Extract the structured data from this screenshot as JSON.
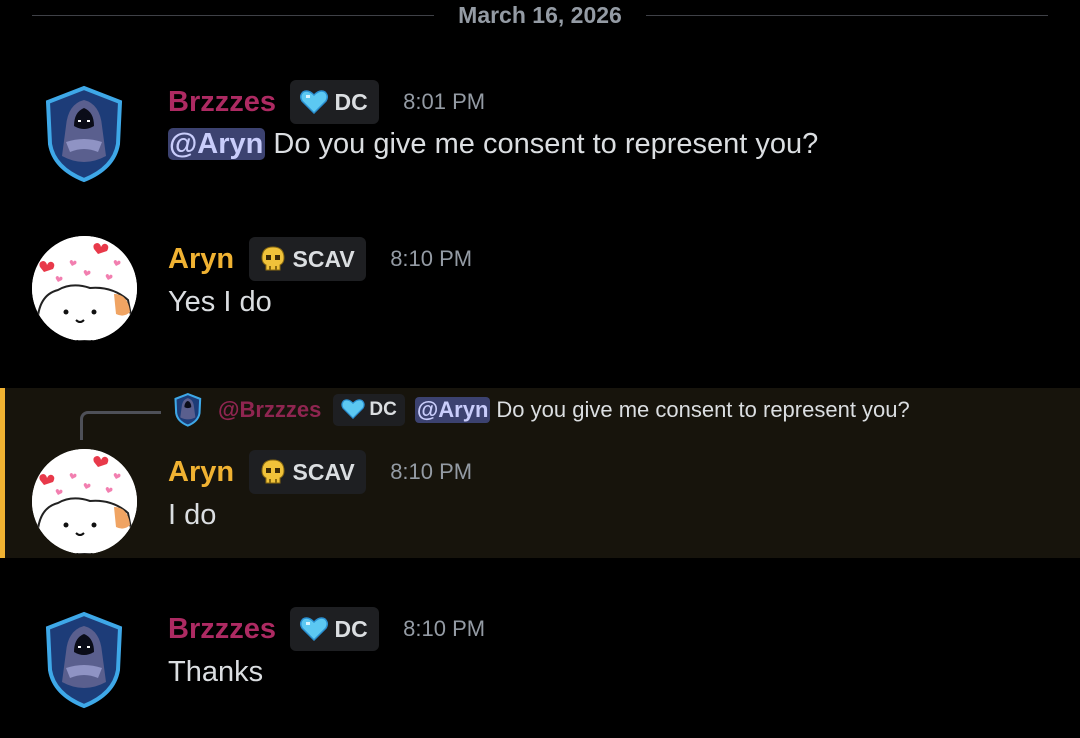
{
  "date_divider": "March 16, 2026",
  "colors": {
    "brzzzes_name": "#ad2a62",
    "aryn_name": "#f0b232",
    "mention_bg": "#3c4270",
    "highlight_bar": "#f0b232"
  },
  "icons": {
    "dc_tag": "blue-heart-icon",
    "scav_tag": "skull-icon",
    "brzzzes_avatar": "hooded-warrior-shield-avatar",
    "aryn_avatar": "cat-with-hearts-avatar"
  },
  "messages": [
    {
      "author": "Brzzzes",
      "tag": "DC",
      "time": "8:01 PM",
      "mention": "@Aryn",
      "text": " Do you give me consent to represent you?"
    },
    {
      "author": "Aryn",
      "tag": "SCAV",
      "time": "8:10 PM",
      "text": "Yes I do"
    },
    {
      "reply": {
        "author": "@Brzzzes",
        "tag": "DC",
        "mention": "@Aryn",
        "text": "Do you give me consent to represent you?"
      },
      "author": "Aryn",
      "tag": "SCAV",
      "time": "8:10 PM",
      "text": "I do"
    },
    {
      "author": "Brzzzes",
      "tag": "DC",
      "time": "8:10 PM",
      "text": "Thanks"
    }
  ]
}
